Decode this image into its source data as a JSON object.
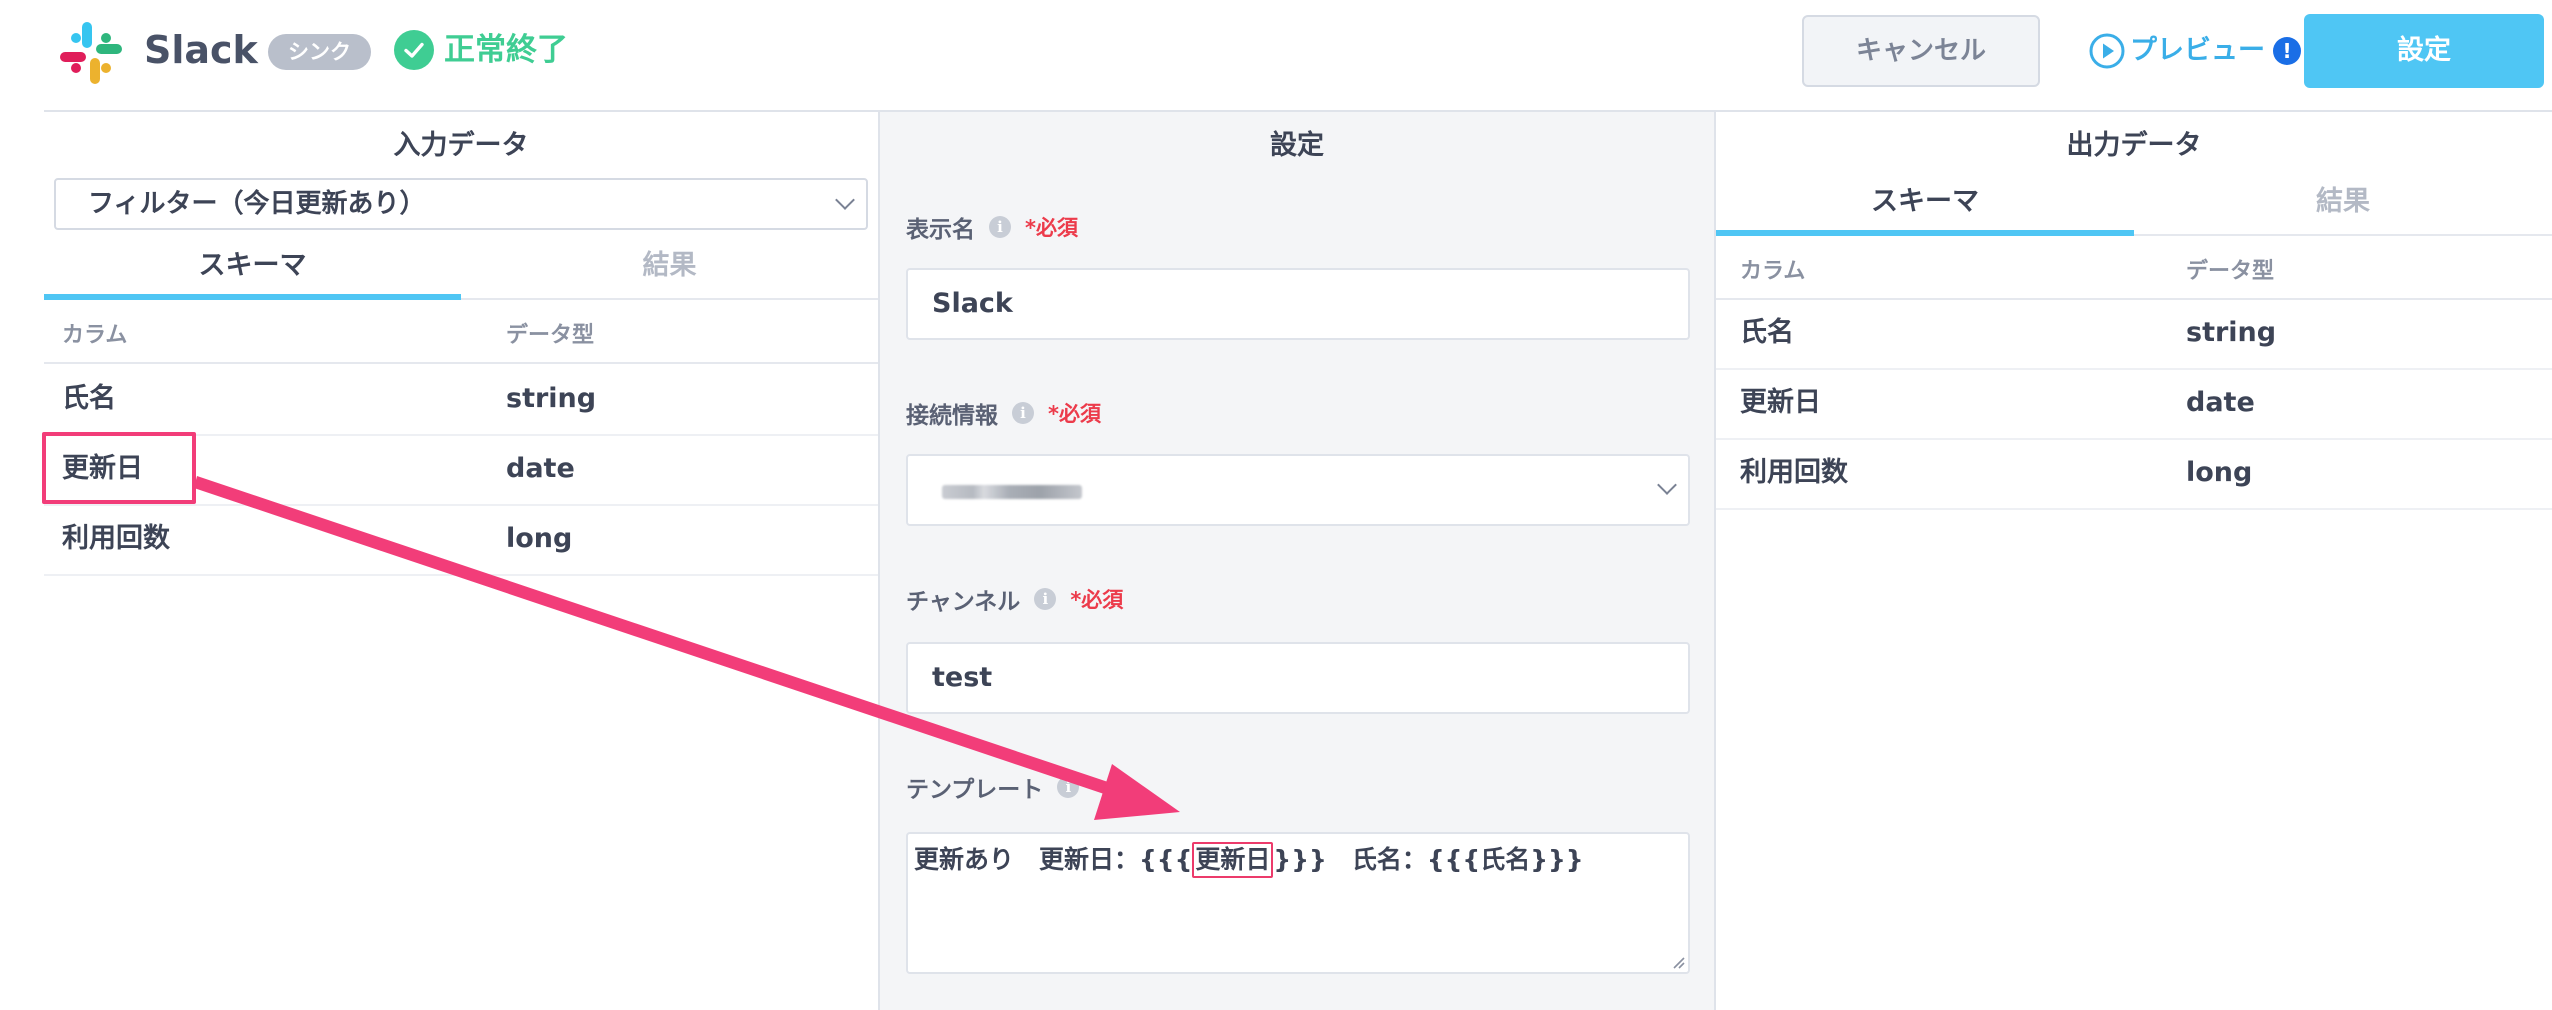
{
  "header": {
    "app_name": "Slack",
    "badge": "シンク",
    "status": "正常終了",
    "cancel_label": "キャンセル",
    "preview_label": "プレビュー",
    "alert_mark": "!",
    "setting_label": "設定"
  },
  "input_panel": {
    "title": "入力データ",
    "dataset": "フィルター（今日更新あり）",
    "tabs": [
      "スキーマ",
      "結果"
    ],
    "columns": [
      "カラム",
      "データ型"
    ],
    "rows": [
      {
        "name": "氏名",
        "type": "string"
      },
      {
        "name": "更新日",
        "type": "date"
      },
      {
        "name": "利用回数",
        "type": "long"
      }
    ]
  },
  "settings_panel": {
    "title": "設定",
    "info_mark": "i",
    "required_mark": "*必須",
    "display_name": {
      "label": "表示名",
      "value": "Slack"
    },
    "connection": {
      "label": "接続情報"
    },
    "channel": {
      "label": "チャンネル",
      "value": "test"
    },
    "template": {
      "label": "テンプレート",
      "before": "更新あり　更新日：{{{",
      "highlight": "更新日",
      "after": "}}}　氏名：{{{氏名}}}"
    }
  },
  "output_panel": {
    "title": "出力データ",
    "tabs": [
      "スキーマ",
      "結果"
    ],
    "columns": [
      "カラム",
      "データ型"
    ],
    "rows": [
      {
        "name": "氏名",
        "type": "string"
      },
      {
        "name": "更新日",
        "type": "date"
      },
      {
        "name": "利用回数",
        "type": "long"
      }
    ]
  },
  "colors": {
    "accent": "#4fc6f4",
    "success": "#3fcd93",
    "required": "#ec3b4b",
    "annotation": "#f23d79"
  },
  "icons": [
    "slack-logo",
    "check-circle-icon",
    "play-circle-icon",
    "alert-icon",
    "info-icon",
    "chevron-down-icon",
    "resize-grip-icon"
  ]
}
